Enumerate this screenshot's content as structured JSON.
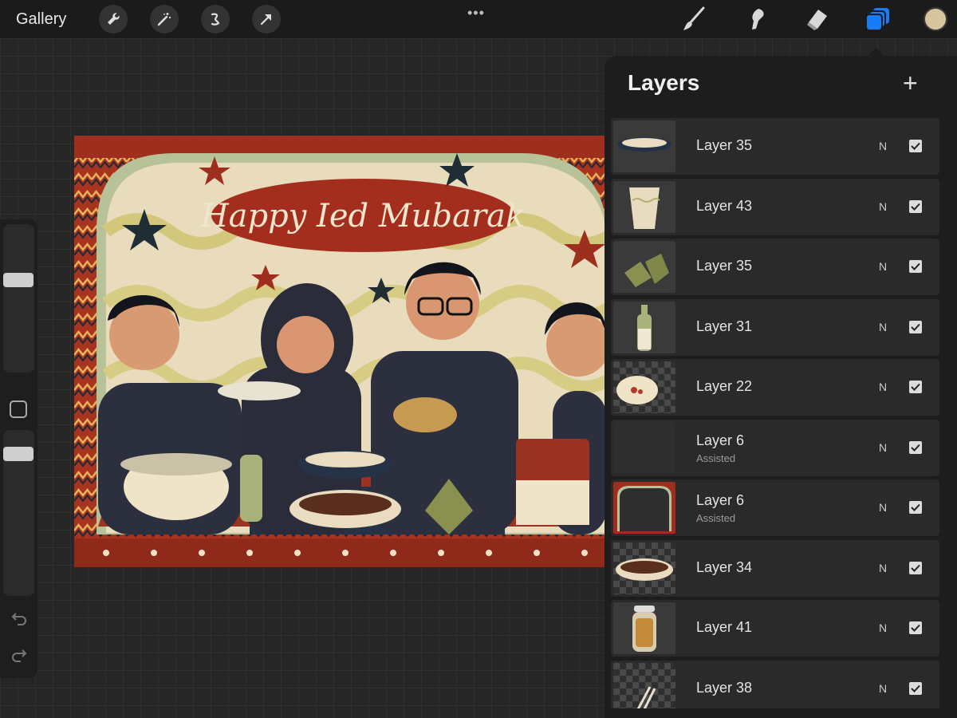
{
  "topbar": {
    "gallery_label": "Gallery",
    "more_label": "•••",
    "tools": [
      "wrench-icon",
      "magic-wand-icon",
      "selection-icon",
      "transform-arrow-icon"
    ],
    "right_tools": [
      "brush-icon",
      "smudge-icon",
      "eraser-icon",
      "layers-icon"
    ],
    "accent": "#1a7cf5",
    "current_color": "#d8c5a0"
  },
  "layers": {
    "title": "Layers",
    "add_label": "+",
    "items": [
      {
        "name": "Layer 35",
        "sub": "",
        "mode": "N",
        "visible": true
      },
      {
        "name": "Layer 43",
        "sub": "",
        "mode": "N",
        "visible": true
      },
      {
        "name": "Layer 35",
        "sub": "",
        "mode": "N",
        "visible": true
      },
      {
        "name": "Layer 31",
        "sub": "",
        "mode": "N",
        "visible": true
      },
      {
        "name": "Layer 22",
        "sub": "",
        "mode": "N",
        "visible": true
      },
      {
        "name": "Layer 6",
        "sub": "Assisted",
        "mode": "N",
        "visible": true
      },
      {
        "name": "Layer 6",
        "sub": "Assisted",
        "mode": "N",
        "visible": true
      },
      {
        "name": "Layer 34",
        "sub": "",
        "mode": "N",
        "visible": true
      },
      {
        "name": "Layer 41",
        "sub": "",
        "mode": "N",
        "visible": true
      },
      {
        "name": "Layer 38",
        "sub": "",
        "mode": "N",
        "visible": true
      }
    ]
  },
  "canvas": {
    "banner_text": "Happy Ied Mubarak"
  }
}
